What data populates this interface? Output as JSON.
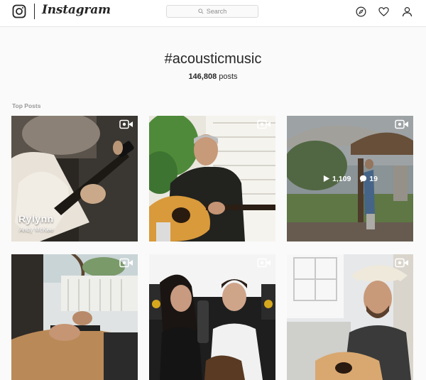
{
  "app": {
    "wordmark": "Instagram"
  },
  "search": {
    "placeholder": "Search"
  },
  "nav": {
    "icons": [
      "explore-compass-icon",
      "activity-heart-icon",
      "profile-user-icon"
    ]
  },
  "hashtag": {
    "title": "#acousticmusic",
    "post_count": "146,808",
    "post_count_suffix": "posts"
  },
  "section": {
    "label": "Top Posts"
  },
  "posts": [
    {
      "type": "video",
      "caption_title": "Rylynn",
      "caption_subtitle": "Andy McKee"
    },
    {
      "type": "video"
    },
    {
      "type": "video",
      "views": "1,109",
      "comments": "19",
      "hovered": true
    },
    {
      "type": "video"
    },
    {
      "type": "video"
    },
    {
      "type": "video"
    }
  ],
  "colors": {
    "background": "#fafafa",
    "header": "#ffffff",
    "border": "#e6e6e6",
    "text": "#262626",
    "muted": "#999999"
  }
}
